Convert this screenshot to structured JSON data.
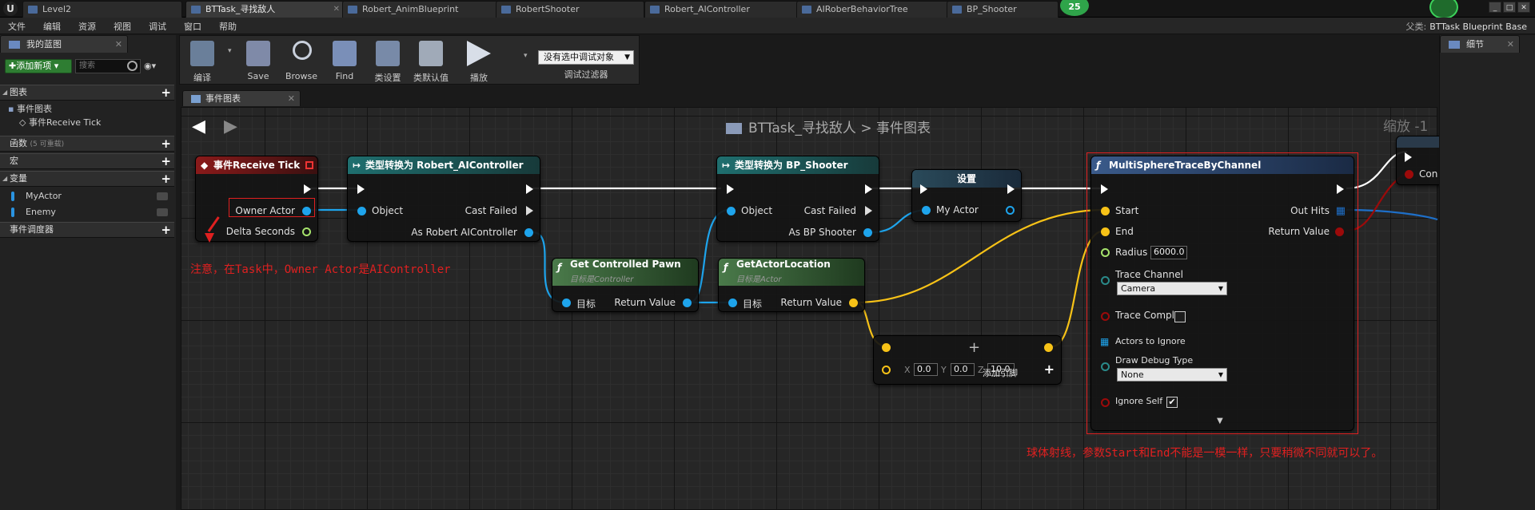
{
  "tabs": [
    {
      "label": "Level2",
      "active": false
    },
    {
      "label": "BTTask_寻找敌人",
      "active": true
    },
    {
      "label": "Robert_AnimBlueprint",
      "active": false
    },
    {
      "label": "RobertShooter",
      "active": false
    },
    {
      "label": "Robert_AIController",
      "active": false
    },
    {
      "label": "AIRoberBehaviorTree",
      "active": false
    },
    {
      "label": "BP_Shooter",
      "active": false
    }
  ],
  "badge": "25",
  "menu": [
    "文件",
    "编辑",
    "资源",
    "视图",
    "调试",
    "窗口",
    "帮助"
  ],
  "parent": {
    "label": "父类:",
    "value": "BTTask Blueprint Base"
  },
  "left": {
    "panel_title": "我的蓝图",
    "add_new": "添加新项",
    "search_placeholder": "搜索",
    "sections": {
      "graphs": "图表",
      "event_graph": "事件图表",
      "receive_tick": "事件Receive Tick",
      "functions": "函数",
      "functions_sub": "(5 可重载)",
      "macros": "宏",
      "variables": "变量",
      "var1": "MyActor",
      "var2": "Enemy",
      "dispatchers": "事件调度器"
    }
  },
  "toolbar": {
    "compile": "编译",
    "save": "Save",
    "browse": "Browse",
    "find": "Find",
    "class_settings": "类设置",
    "class_defaults": "类默认值",
    "play": "播放",
    "debug_select": "没有选中调试对象",
    "debug_filter": "调试过滤器"
  },
  "graph_tab": "事件图表",
  "breadcrumb": {
    "task": "BTTask_寻找敌人",
    "sep": ">",
    "graph": "事件图表"
  },
  "zoom": "缩放 -1",
  "right": {
    "panel_title": "细节"
  },
  "nodes": {
    "tick": {
      "title": "事件Receive Tick",
      "owner": "Owner Actor",
      "delta": "Delta Seconds"
    },
    "cast_ai": {
      "title": "类型转换为 Robert_AIController",
      "object": "Object",
      "failed": "Cast Failed",
      "as": "As Robert AIController"
    },
    "get_pawn": {
      "title": "Get Controlled Pawn",
      "sub": "目标是Controller",
      "target": "目标",
      "ret": "Return Value"
    },
    "cast_bp": {
      "title": "类型转换为 BP_Shooter",
      "object": "Object",
      "failed": "Cast Failed",
      "as": "As BP Shooter"
    },
    "get_loc": {
      "title": "GetActorLocation",
      "sub": "目标是Actor",
      "target": "目标",
      "ret": "Return Value"
    },
    "set": {
      "title": "设置",
      "my_actor": "My Actor"
    },
    "add": {
      "x_label": "X",
      "x": "0.0",
      "y_label": "Y",
      "y": "0.0",
      "z_label": "Z",
      "z": "10.0",
      "add_pin": "添加引脚"
    },
    "trace": {
      "title": "MultiSphereTraceByChannel",
      "start": "Start",
      "end": "End",
      "radius": "Radius",
      "radius_val": "6000.0",
      "trace_channel": "Trace Channel",
      "trace_channel_val": "Camera",
      "trace_complex": "Trace Complex",
      "actors_ignore": "Actors to Ignore",
      "draw_debug": "Draw Debug Type",
      "draw_debug_val": "None",
      "ignore_self": "Ignore Self",
      "out_hits": "Out Hits",
      "ret": "Return Value"
    },
    "partial": {
      "label": "Con"
    }
  },
  "annotations": {
    "note1": "注意，在Task中，Owner Actor是AIController",
    "note2": "球体射线，参数Start和End不能是一模一样，只要稍微不同就可以了。"
  },
  "colors": {
    "object_pin": "#1ea4ec",
    "vector_pin": "#f7c217",
    "float_pin": "#a6e36c",
    "bool_pin": "#9c0a0a",
    "exec": "#ffffff",
    "annotation": "#e02020",
    "event_header": "#8a1a1a",
    "cast_header": "#1f6f6f",
    "function_header": "#4a7a4a",
    "trace_header": "#3a5a8a"
  }
}
